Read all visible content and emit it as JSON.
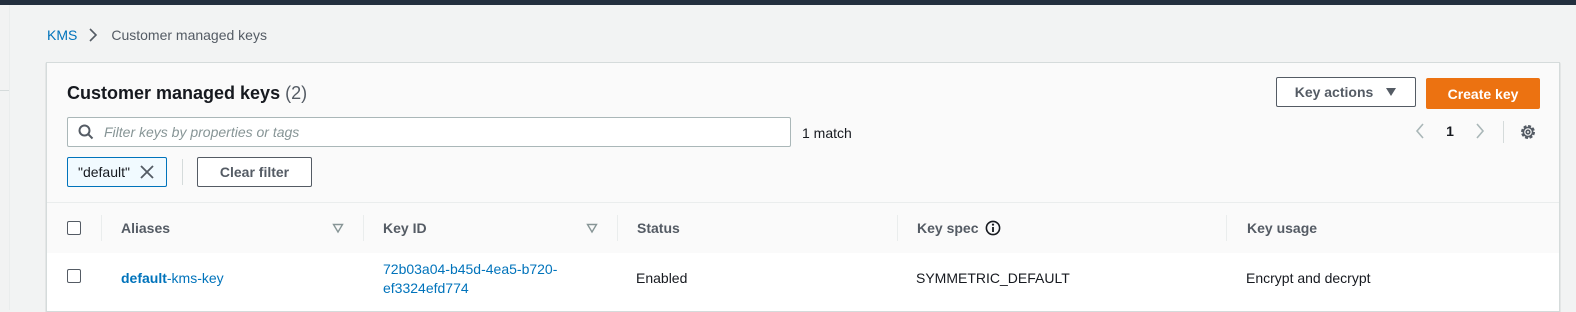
{
  "breadcrumb": {
    "root": "KMS",
    "current": "Customer managed keys"
  },
  "panel": {
    "title": "Customer managed keys",
    "count": "(2)",
    "key_actions_label": "Key actions",
    "create_key_label": "Create key"
  },
  "filter": {
    "placeholder": "Filter keys by properties or tags",
    "match_text": "1 match",
    "token_label": "\"default\"",
    "clear_label": "Clear filter"
  },
  "pagination": {
    "current_page": "1"
  },
  "table": {
    "columns": [
      "Aliases",
      "Key ID",
      "Status",
      "Key spec",
      "Key usage"
    ],
    "rows": [
      {
        "alias_bold": "default",
        "alias_rest": "-kms-key",
        "key_id_line1": "72b03a04-b45d-4ea5-b720-",
        "key_id_line2": "ef3324efd774",
        "status": "Enabled",
        "key_spec": "SYMMETRIC_DEFAULT",
        "key_usage": "Encrypt and decrypt"
      }
    ]
  },
  "icons": {
    "breadcrumb_separator": "chevron-right-icon",
    "search": "search-icon",
    "key_actions": "caret-down-icon",
    "token_dismiss": "close-icon",
    "prev_page": "chevron-left-icon",
    "next_page": "chevron-right-icon",
    "settings": "gear-icon",
    "sort": "sort-down-icon",
    "info": "info-icon"
  },
  "colors": {
    "link": "#0073bb",
    "primary_button": "#ec7211",
    "top_bar": "#232f3e",
    "page_background": "#f2f3f3"
  }
}
